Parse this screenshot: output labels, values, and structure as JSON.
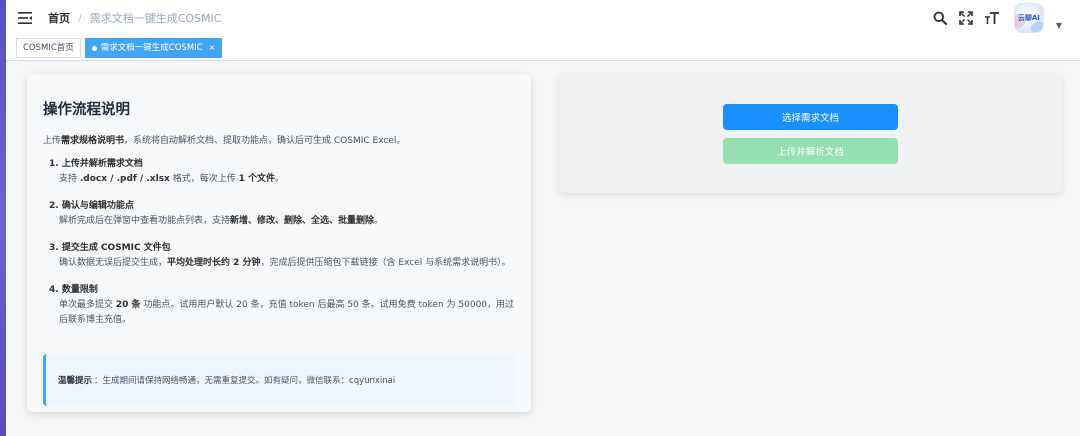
{
  "navbar": {
    "breadcrumb": {
      "home": "首页",
      "separator": "/",
      "current": "需求文档一键生成COSMIC"
    },
    "avatar_text": "云聊AI"
  },
  "tags": [
    {
      "label": "COSMIC首页",
      "active": false
    },
    {
      "label": "需求文档一键生成COSMIC",
      "active": true,
      "close": "×"
    }
  ],
  "guide": {
    "title": "操作流程说明",
    "intro": {
      "prefix": "上传",
      "bold": "需求规格说明书",
      "suffix": "，系统将自动解析文档、提取功能点，确认后可生成 COSMIC Excel。"
    },
    "steps": [
      {
        "head": "1. 上传并解析需求文档",
        "desc_parts": [
          "支持 ",
          ".docx / .pdf / .xlsx",
          " 格式，每次上传 ",
          "1 个文件",
          "。"
        ]
      },
      {
        "head": "2. 确认与编辑功能点",
        "desc_parts": [
          "解析完成后在弹窗中查看功能点列表，支持",
          "新增、修改、删除、全选、批量删除",
          "。"
        ]
      },
      {
        "head": "3. 提交生成 COSMIC 文件包",
        "desc_parts": [
          "确认数据无误后提交生成，",
          "平均处理时长约 2 分钟",
          "，完成后提供压缩包下载链接（含 Excel 与系统需求说明书）。"
        ]
      },
      {
        "head": "4. 数量限制",
        "desc_parts": [
          "单次最多提交 ",
          "20 条",
          " 功能点。试用用户默认 20 条，充值 token 后最高 50 条。试用免费 token 为 50000，用过后联系博主充值。"
        ]
      }
    ],
    "tip": {
      "label": "温馨提示",
      "text": "：生成期间请保持网络畅通，无需重复提交。如有疑问，微信联系：cqyunxinai"
    }
  },
  "actions": {
    "select_label": "选择需求文档",
    "upload_label": "上传并解析文档"
  },
  "colors": {
    "primary": "#1890ff",
    "disabled_green": "#95e0b0",
    "active_tag": "#42a4f5",
    "sidebar": "#5b4fbf"
  }
}
